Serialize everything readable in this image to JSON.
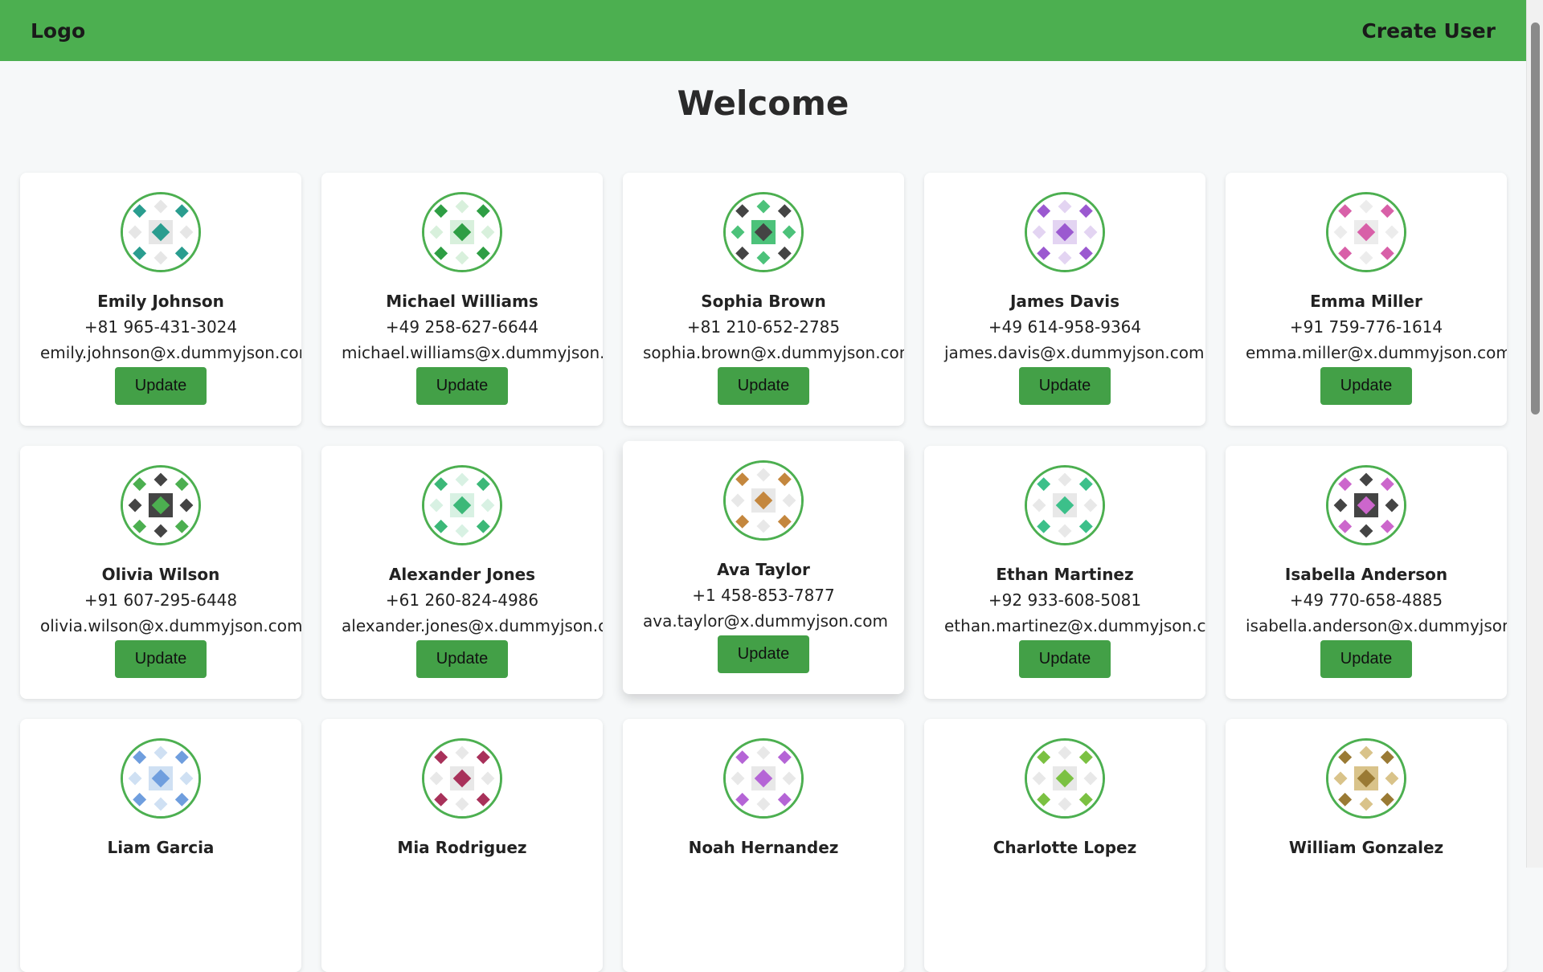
{
  "header": {
    "logo": "Logo",
    "create_user": "Create User"
  },
  "title": "Welcome",
  "colors": {
    "header_bg": "#4caf50",
    "button_bg": "#43a047",
    "avatar_ring": "#4caf50"
  },
  "update_label": "Update",
  "users": [
    {
      "name": "Emily Johnson",
      "phone": "+81 965-431-3024",
      "email": "emily.johnson@x.dummyjson.com",
      "avatar": {
        "fg": "#2a9d8f",
        "bg": "#e6e6e6"
      }
    },
    {
      "name": "Michael Williams",
      "phone": "+49 258-627-6644",
      "email": "michael.williams@x.dummyjson.com",
      "avatar": {
        "fg": "#2e9e44",
        "bg": "#d8f0dc"
      }
    },
    {
      "name": "Sophia Brown",
      "phone": "+81 210-652-2785",
      "email": "sophia.brown@x.dummyjson.com",
      "avatar": {
        "fg": "#444444",
        "bg": "#4cc27a"
      }
    },
    {
      "name": "James Davis",
      "phone": "+49 614-958-9364",
      "email": "james.davis@x.dummyjson.com",
      "avatar": {
        "fg": "#9b59d0",
        "bg": "#e3d4f2"
      }
    },
    {
      "name": "Emma Miller",
      "phone": "+91 759-776-1614",
      "email": "emma.miller@x.dummyjson.com",
      "avatar": {
        "fg": "#d860a8",
        "bg": "#ececec"
      }
    },
    {
      "name": "Olivia Wilson",
      "phone": "+91 607-295-6448",
      "email": "olivia.wilson@x.dummyjson.com",
      "avatar": {
        "fg": "#4caf50",
        "bg": "#444444"
      }
    },
    {
      "name": "Alexander Jones",
      "phone": "+61 260-824-4986",
      "email": "alexander.jones@x.dummyjson.com",
      "avatar": {
        "fg": "#3cb878",
        "bg": "#d8f1e3"
      }
    },
    {
      "name": "Ava Taylor",
      "phone": "+1 458-853-7877",
      "email": "ava.taylor@x.dummyjson.com",
      "avatar": {
        "fg": "#c4873e",
        "bg": "#e8e8e8"
      }
    },
    {
      "name": "Ethan Martinez",
      "phone": "+92 933-608-5081",
      "email": "ethan.martinez@x.dummyjson.com",
      "avatar": {
        "fg": "#3cc08a",
        "bg": "#e8e8e8"
      }
    },
    {
      "name": "Isabella Anderson",
      "phone": "+49 770-658-4885",
      "email": "isabella.anderson@x.dummyjson.com",
      "avatar": {
        "fg": "#cc66cc",
        "bg": "#444444"
      }
    },
    {
      "name": "Liam Garcia",
      "phone": "",
      "email": "",
      "avatar": {
        "fg": "#6f9ede",
        "bg": "#cfe0f3"
      }
    },
    {
      "name": "Mia Rodriguez",
      "phone": "",
      "email": "",
      "avatar": {
        "fg": "#a8315a",
        "bg": "#e8e8e8"
      }
    },
    {
      "name": "Noah Hernandez",
      "phone": "",
      "email": "",
      "avatar": {
        "fg": "#b565d6",
        "bg": "#e8e8e8"
      }
    },
    {
      "name": "Charlotte Lopez",
      "phone": "",
      "email": "",
      "avatar": {
        "fg": "#7bc142",
        "bg": "#e8e8e8"
      }
    },
    {
      "name": "William Gonzalez",
      "phone": "",
      "email": "",
      "avatar": {
        "fg": "#9a7a34",
        "bg": "#d9c38a"
      }
    }
  ]
}
